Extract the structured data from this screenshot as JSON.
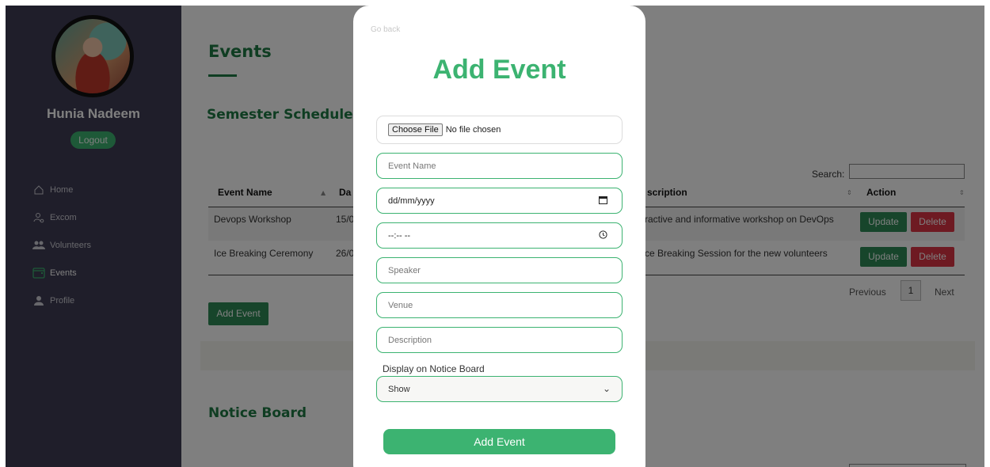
{
  "sidebar": {
    "user_name": "Hunia Nadeem",
    "logout_label": "Logout",
    "items": [
      {
        "label": "Home",
        "icon": "home-icon"
      },
      {
        "label": "Excom",
        "icon": "user-gear-icon"
      },
      {
        "label": "Volunteers",
        "icon": "users-icon"
      },
      {
        "label": "Events",
        "icon": "calendar-icon",
        "active": true
      },
      {
        "label": "Profile",
        "icon": "person-icon"
      }
    ]
  },
  "main": {
    "title": "Events",
    "semester_title": "Semester Schedule",
    "search_label": "Search:",
    "columns": [
      "Event Name",
      "Da",
      "scription",
      "Action"
    ],
    "rows": [
      {
        "name": "Devops Workshop",
        "date": "15/0",
        "description": "ractive and informative workshop on DevOps"
      },
      {
        "name": "Ice Breaking Ceremony",
        "date": "26/0",
        "description": "ce Breaking Session for the new volunteers"
      }
    ],
    "update_label": "Update",
    "delete_label": "Delete",
    "pagination": {
      "previous": "Previous",
      "page": "1",
      "next": "Next"
    },
    "add_event_label": "Add Event",
    "notice_title": "Notice Board"
  },
  "modal": {
    "go_back": "Go back",
    "title": "Add Event",
    "file_button": "Choose File",
    "file_status": "No file chosen",
    "event_name_placeholder": "Event Name",
    "date_placeholder": "dd/mm/yyyy",
    "time_placeholder": "--:-- --",
    "speaker_placeholder": "Speaker",
    "venue_placeholder": "Venue",
    "description_placeholder": "Description",
    "notice_label": "Display on Notice Board",
    "notice_value": "Show",
    "submit_label": "Add Event"
  },
  "colors": {
    "accent": "#3cb371",
    "sidebar": "#3f3d55",
    "danger": "#dc3545",
    "heading": "#1f7a44"
  }
}
